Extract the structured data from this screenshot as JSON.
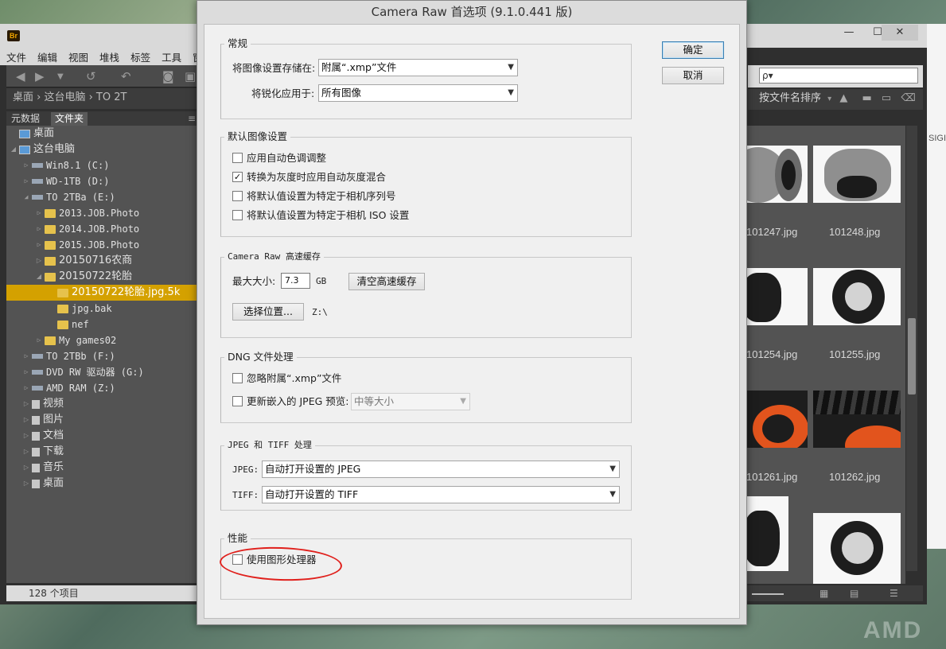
{
  "dialog": {
    "title": "Camera Raw 首选项 (9.1.0.441 版)",
    "ok_label": "确定",
    "cancel_label": "取消",
    "general": {
      "title": "常规",
      "save_settings_label": "将图像设置存储在:",
      "save_settings_value": "附属“.xmp”文件",
      "sharpening_label": "将锐化应用于:",
      "sharpening_value": "所有图像"
    },
    "defaults": {
      "title": "默认图像设置",
      "auto_tone_label": "应用自动色调调整",
      "auto_tone_checked": false,
      "grayscale_label": "转换为灰度时应用自动灰度混合",
      "grayscale_checked": true,
      "serial_label": "将默认值设置为特定于相机序列号",
      "serial_checked": false,
      "iso_label": "将默认值设置为特定于相机 ISO 设置",
      "iso_checked": false,
      "check_mark": "✓"
    },
    "cache": {
      "title": "Camera Raw 高速缓存",
      "max_size_label": "最大大小:",
      "max_size_value": "7.3",
      "unit": "GB",
      "purge_label": "清空高速缓存",
      "location_label": "选择位置...",
      "location_value": "Z:\\"
    },
    "dng": {
      "title": "DNG 文件处理",
      "ignore_xmp_label": "忽略附属“.xmp”文件",
      "ignore_xmp_checked": false,
      "update_jpeg_label": "更新嵌入的 JPEG 预览:",
      "update_jpeg_checked": false,
      "preview_size_value": "中等大小"
    },
    "jpeg_tiff": {
      "title": "JPEG 和 TIFF 处理",
      "jpeg_label": "JPEG:",
      "jpeg_value": "自动打开设置的 JPEG",
      "tiff_label": "TIFF:",
      "tiff_value": "自动打开设置的 TIFF"
    },
    "performance": {
      "title": "性能",
      "gpu_label": "使用图形处理器",
      "gpu_checked": false
    }
  },
  "bridge": {
    "logo": "Br",
    "window_controls": {
      "minimize": "—",
      "maximize": "☐",
      "close": "✕"
    },
    "menu": [
      "文件",
      "编辑",
      "视图",
      "堆栈",
      "标签",
      "工具",
      "窗"
    ],
    "path": "桌面 › 这台电脑 › TO 2T",
    "panel_tabs": [
      "元数据",
      "文件夹"
    ],
    "tree": [
      {
        "label": "桌面",
        "depth": 0,
        "icon": "monitor-icon"
      },
      {
        "label": "这台电脑",
        "depth": 0,
        "icon": "computer-icon",
        "expanded": true
      },
      {
        "label": "Win8.1 (C:)",
        "depth": 1,
        "icon": "drive-icon"
      },
      {
        "label": "WD-1TB (D:)",
        "depth": 1,
        "icon": "drive-icon"
      },
      {
        "label": "TO 2TBa (E:)",
        "depth": 1,
        "icon": "drive-icon",
        "expanded": true
      },
      {
        "label": "2013.JOB.Photo",
        "depth": 2,
        "icon": "folder-icon"
      },
      {
        "label": "2014.JOB.Photo",
        "depth": 2,
        "icon": "folder-icon"
      },
      {
        "label": "2015.JOB.Photo",
        "depth": 2,
        "icon": "folder-icon"
      },
      {
        "label": "20150716农商",
        "depth": 2,
        "icon": "folder-icon"
      },
      {
        "label": "20150722轮胎",
        "depth": 2,
        "icon": "folder-icon",
        "expanded": true
      },
      {
        "label": "20150722轮胎.jpg.5k",
        "depth": 3,
        "icon": "folder-icon",
        "selected": true
      },
      {
        "label": "jpg.bak",
        "depth": 3,
        "icon": "folder-icon"
      },
      {
        "label": "nef",
        "depth": 3,
        "icon": "folder-icon"
      },
      {
        "label": "My games02",
        "depth": 2,
        "icon": "folder-icon"
      },
      {
        "label": "TO 2TBb (F:)",
        "depth": 1,
        "icon": "drive-icon"
      },
      {
        "label": "DVD RW 驱动器 (G:)",
        "depth": 1,
        "icon": "drive-icon"
      },
      {
        "label": "AMD RAM (Z:)",
        "depth": 1,
        "icon": "drive-icon"
      },
      {
        "label": "视频",
        "depth": 1,
        "icon": "library-icon"
      },
      {
        "label": "图片",
        "depth": 1,
        "icon": "library-icon"
      },
      {
        "label": "文档",
        "depth": 1,
        "icon": "library-icon"
      },
      {
        "label": "下载",
        "depth": 1,
        "icon": "library-icon"
      },
      {
        "label": "音乐",
        "depth": 1,
        "icon": "library-icon"
      },
      {
        "label": "桌面",
        "depth": 1,
        "icon": "library-icon"
      }
    ],
    "item_count": "128 个项目",
    "search_placeholder": "ρ▾",
    "sort_label": "按文件名排序",
    "thumbnails": [
      "101247.jpg",
      "101248.jpg",
      "101254.jpg",
      "101255.jpg",
      "101261.jpg",
      "101262.jpg"
    ],
    "side_text": "SIGI",
    "watermark": "AMD"
  }
}
